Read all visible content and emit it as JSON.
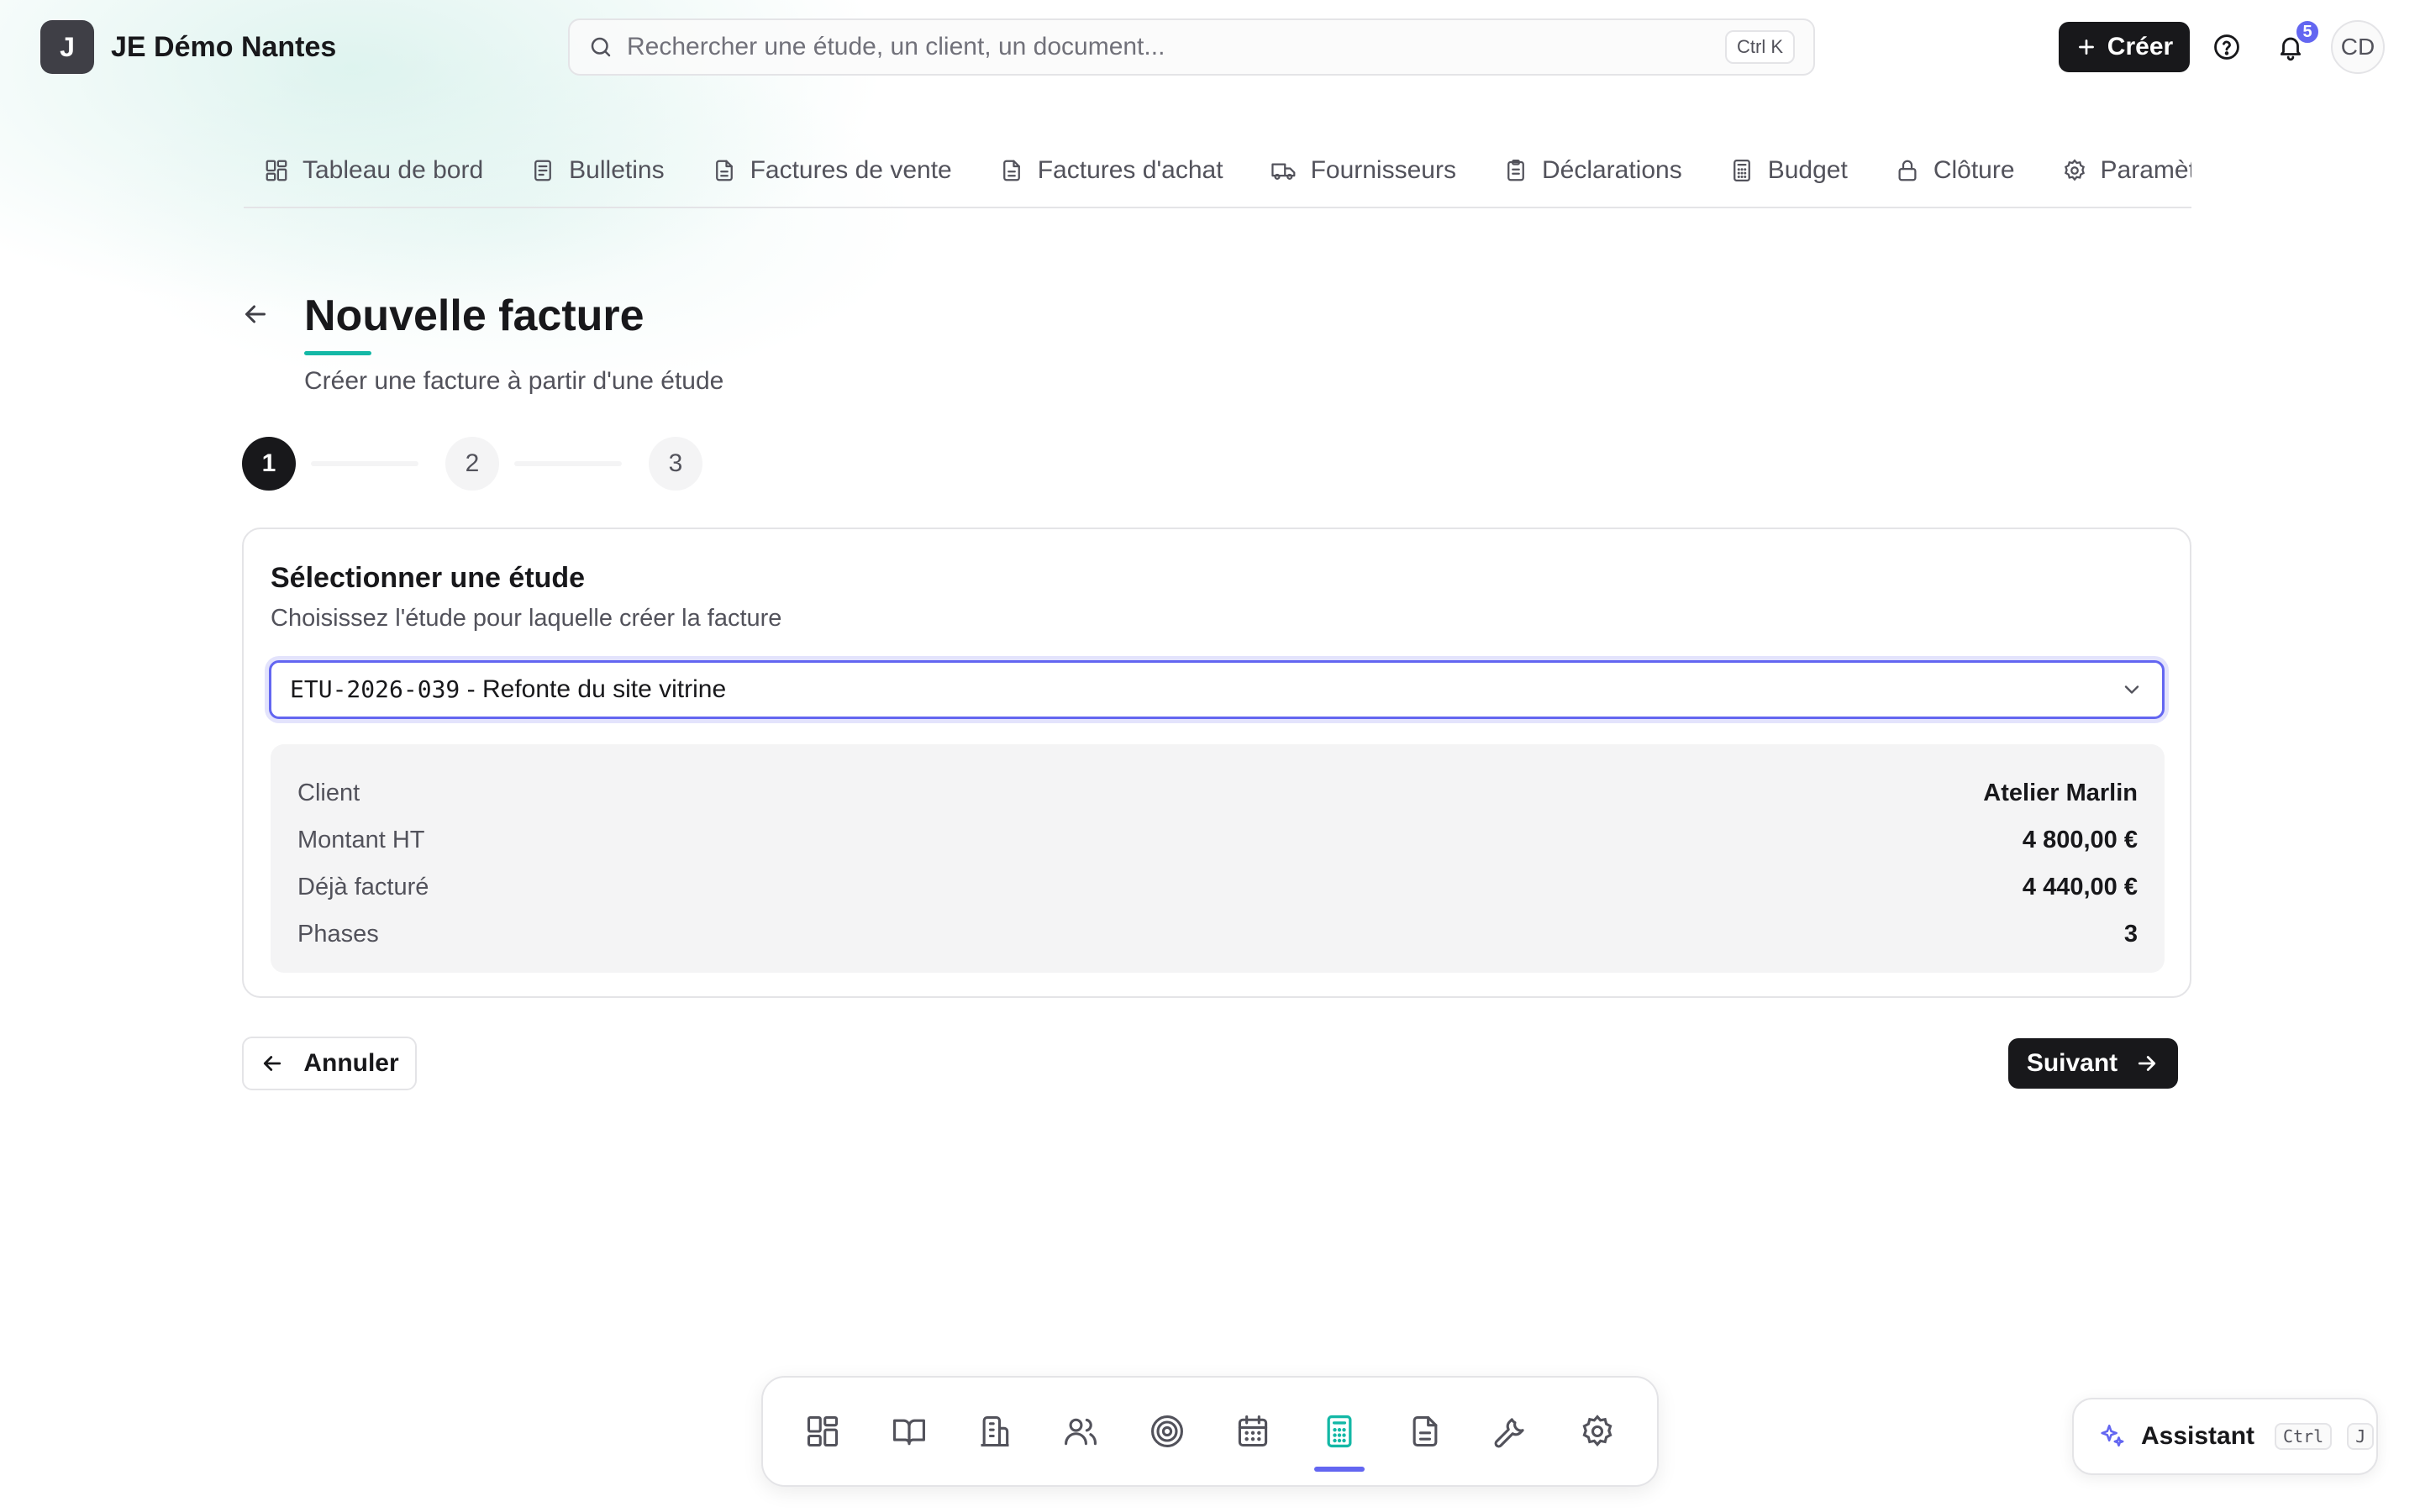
{
  "header": {
    "logo_letter": "J",
    "org_name": "JE Démo Nantes",
    "search_placeholder": "Rechercher une étude, un client, un document...",
    "search_shortcut": "Ctrl K",
    "create_label": "Créer",
    "notifications_count": "5",
    "user_initials": "CD"
  },
  "nav": {
    "items": [
      {
        "label": "Tableau de bord",
        "icon": "grid-icon"
      },
      {
        "label": "Bulletins",
        "icon": "document-icon"
      },
      {
        "label": "Factures de vente",
        "icon": "document-icon"
      },
      {
        "label": "Factures d'achat",
        "icon": "document-icon"
      },
      {
        "label": "Fournisseurs",
        "icon": "truck-icon"
      },
      {
        "label": "Déclarations",
        "icon": "clipboard-icon"
      },
      {
        "label": "Budget",
        "icon": "calculator-icon"
      },
      {
        "label": "Clôture",
        "icon": "lock-icon"
      },
      {
        "label": "Paramètres",
        "icon": "gear-icon"
      }
    ]
  },
  "page": {
    "title": "Nouvelle facture",
    "subtitle": "Créer une facture à partir d'une étude"
  },
  "stepper": {
    "steps": [
      "1",
      "2",
      "3"
    ],
    "active": 1
  },
  "card": {
    "title": "Sélectionner une étude",
    "description": "Choisissez l'étude pour laquelle créer la facture",
    "select_code": "ETU-2026-039",
    "select_separator": "-",
    "select_name": "Refonte du site vitrine",
    "info": [
      {
        "label": "Client",
        "value": "Atelier Marlin"
      },
      {
        "label": "Montant HT",
        "value": "4 800,00 €"
      },
      {
        "label": "Déjà facturé",
        "value": "4 440,00 €"
      },
      {
        "label": "Phases",
        "value": "3"
      }
    ]
  },
  "actions": {
    "cancel_label": "Annuler",
    "next_label": "Suivant"
  },
  "dock": {
    "items": [
      "grid-icon",
      "book-icon",
      "building-icon",
      "users-icon",
      "target-icon",
      "calendar-icon",
      "calculator-icon",
      "document-icon",
      "wrench-icon",
      "gear-icon"
    ],
    "active": "calculator-icon"
  },
  "assistant": {
    "label": "Assistant",
    "shortcut_1": "Ctrl",
    "shortcut_2": "J"
  },
  "colors": {
    "accent": "#6366f1",
    "teal": "#14b8a6",
    "primary_dark": "#18181b"
  }
}
